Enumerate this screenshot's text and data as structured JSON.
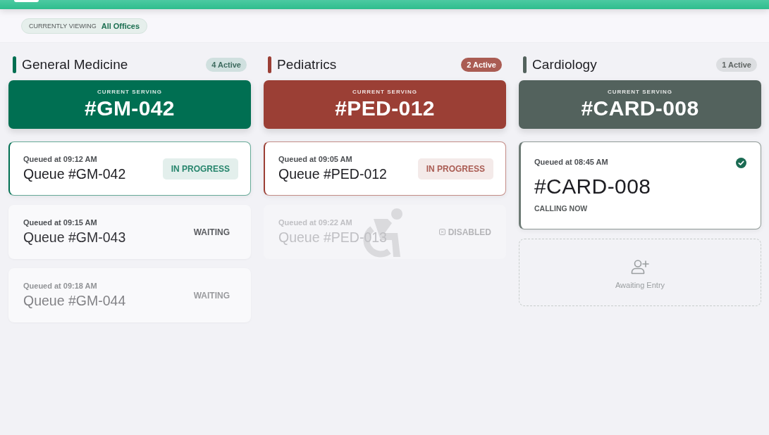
{
  "filter": {
    "label": "CURRENTLY VIEWING",
    "value": "All Offices"
  },
  "departments": [
    {
      "name": "General Medicine",
      "color": "#006f52",
      "badge": {
        "text": "4 Active",
        "highlighted": false
      },
      "serving": {
        "label": "CURRENT SERVING",
        "number": "#GM-042"
      },
      "tickets": [
        {
          "kind": "in_progress",
          "time": "Queued at 09:12 AM",
          "title": "Queue #GM-042",
          "status": "IN PROGRESS",
          "faded": false
        },
        {
          "kind": "waiting",
          "time": "Queued at 09:15 AM",
          "title": "Queue #GM-043",
          "status": "WAITING",
          "faded": false
        },
        {
          "kind": "waiting",
          "time": "Queued at 09:18 AM",
          "title": "Queue #GM-044",
          "status": "WAITING",
          "faded": true
        }
      ]
    },
    {
      "name": "Pediatrics",
      "color": "#9b3f35",
      "badge": {
        "text": "2 Active",
        "highlighted": true
      },
      "serving": {
        "label": "CURRENT SERVING",
        "number": "#PED-012"
      },
      "tickets": [
        {
          "kind": "in_progress",
          "time": "Queued at 09:05 AM",
          "title": "Queue #PED-012",
          "status": "IN PROGRESS",
          "faded": false
        },
        {
          "kind": "disabled",
          "time": "Queued at 09:22 AM",
          "title": "Queue #PED-013",
          "status": "DISABLED",
          "faded": false
        }
      ]
    },
    {
      "name": "Cardiology",
      "color": "#53625d",
      "badge": {
        "text": "1 Active",
        "highlighted": false
      },
      "serving": {
        "label": "CURRENT SERVING",
        "number": "#CARD-008"
      },
      "tickets": [
        {
          "kind": "calling",
          "time": "Queued at 08:45 AM",
          "title": "#CARD-008",
          "status": "CALLING NOW",
          "faded": false
        },
        {
          "kind": "empty",
          "title": "Awaiting Entry",
          "faded": false
        }
      ]
    }
  ]
}
